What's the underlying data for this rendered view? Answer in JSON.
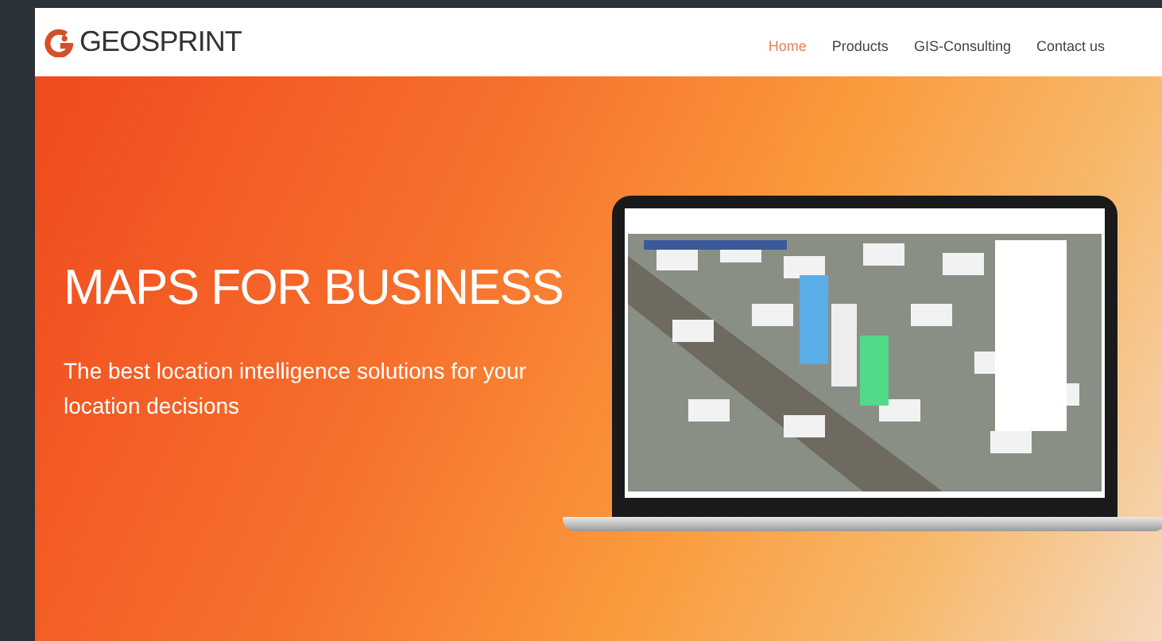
{
  "header": {
    "logo_text": "GEOSPRINT",
    "nav": [
      {
        "label": "Home",
        "selected": true
      },
      {
        "label": "Products",
        "selected": false
      },
      {
        "label": "GIS-Consulting",
        "selected": false
      },
      {
        "label": "Contact us",
        "selected": false
      }
    ]
  },
  "hero": {
    "title": "MAPS FOR BUSINESS",
    "subtitle": "The best location intelligence solutions for your location decisions"
  }
}
